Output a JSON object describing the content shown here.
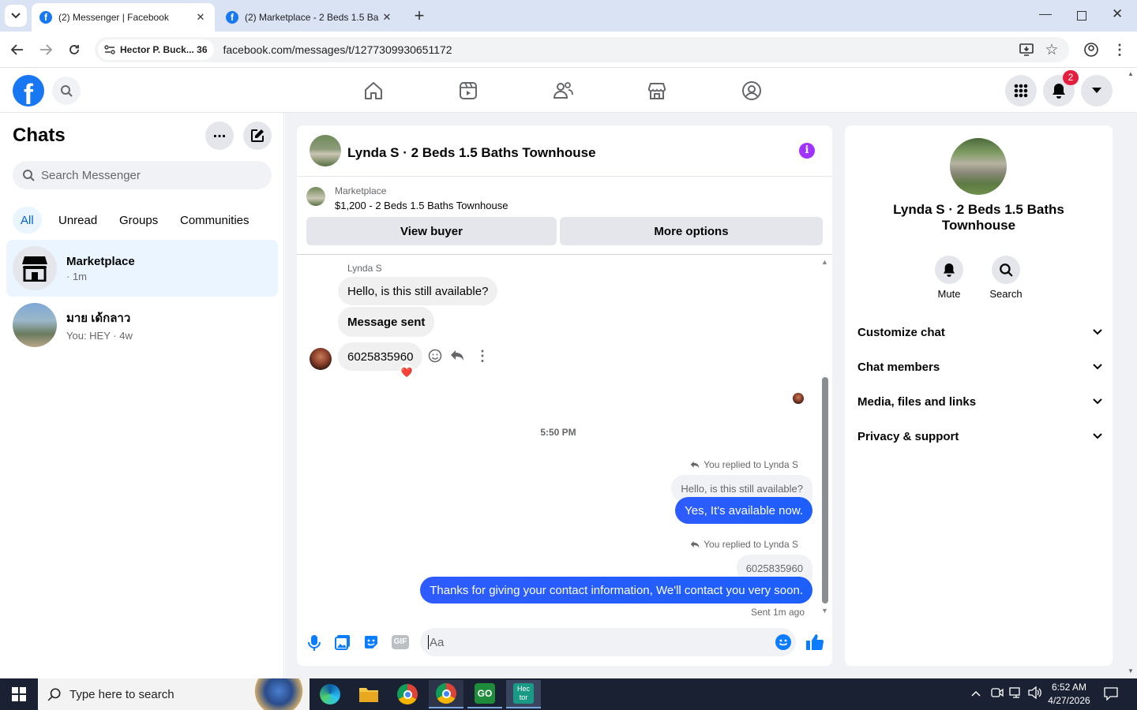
{
  "browser": {
    "tabs": [
      {
        "title": "(2) Messenger | Facebook",
        "active": true
      },
      {
        "title": "(2) Marketplace - 2 Beds 1.5 Ba",
        "active": false
      }
    ],
    "profile_chip": "Hector P. Buck... 36",
    "url": "facebook.com/messages/t/1277309930651172"
  },
  "fb": {
    "notifications_count": "2"
  },
  "left": {
    "title": "Chats",
    "search_placeholder": "Search Messenger",
    "filters": [
      "All",
      "Unread",
      "Groups",
      "Communities"
    ],
    "chats": [
      {
        "name": "Marketplace",
        "preview": "· 1m"
      },
      {
        "name": "มาย เด้กลาว",
        "preview": "You: HEY · 4w"
      }
    ]
  },
  "chat": {
    "header_title": "Lynda S · 2 Beds 1.5 Baths Townhouse",
    "listing_source": "Marketplace",
    "listing_text": "$1,200 - 2 Beds 1.5 Baths Townhouse",
    "view_buyer": "View buyer",
    "more_options": "More options",
    "sender_name": "Lynda S",
    "msg1": "Hello, is this still available?",
    "msg2": "Message sent",
    "msg3": "6025835960",
    "reaction": "❤️",
    "timestamp": "5:50 PM",
    "reply1_label": "You replied to Lynda S",
    "reply1_quote": "Hello, is this still available?",
    "reply1_text": "Yes, It's available now.",
    "reply2_label": "You replied to Lynda S",
    "reply2_quote": "6025835960",
    "reply2_text": "Thanks for giving your contact information, We'll contact you very soon.",
    "sent_status": "Sent 1m ago",
    "composer_placeholder": "Aa"
  },
  "info": {
    "name": "Lynda S · 2 Beds 1.5 Baths Townhouse",
    "mute": "Mute",
    "search": "Search",
    "sections": [
      "Customize chat",
      "Chat members",
      "Media, files and links",
      "Privacy & support"
    ]
  },
  "taskbar": {
    "search_placeholder": "Type here to search",
    "time": "6:52 AM",
    "date": "4/27/2026"
  },
  "colors": {
    "fb_blue": "#1877f2",
    "sent_bubble": "#1d5ffb",
    "info_purple": "#a033ff"
  }
}
